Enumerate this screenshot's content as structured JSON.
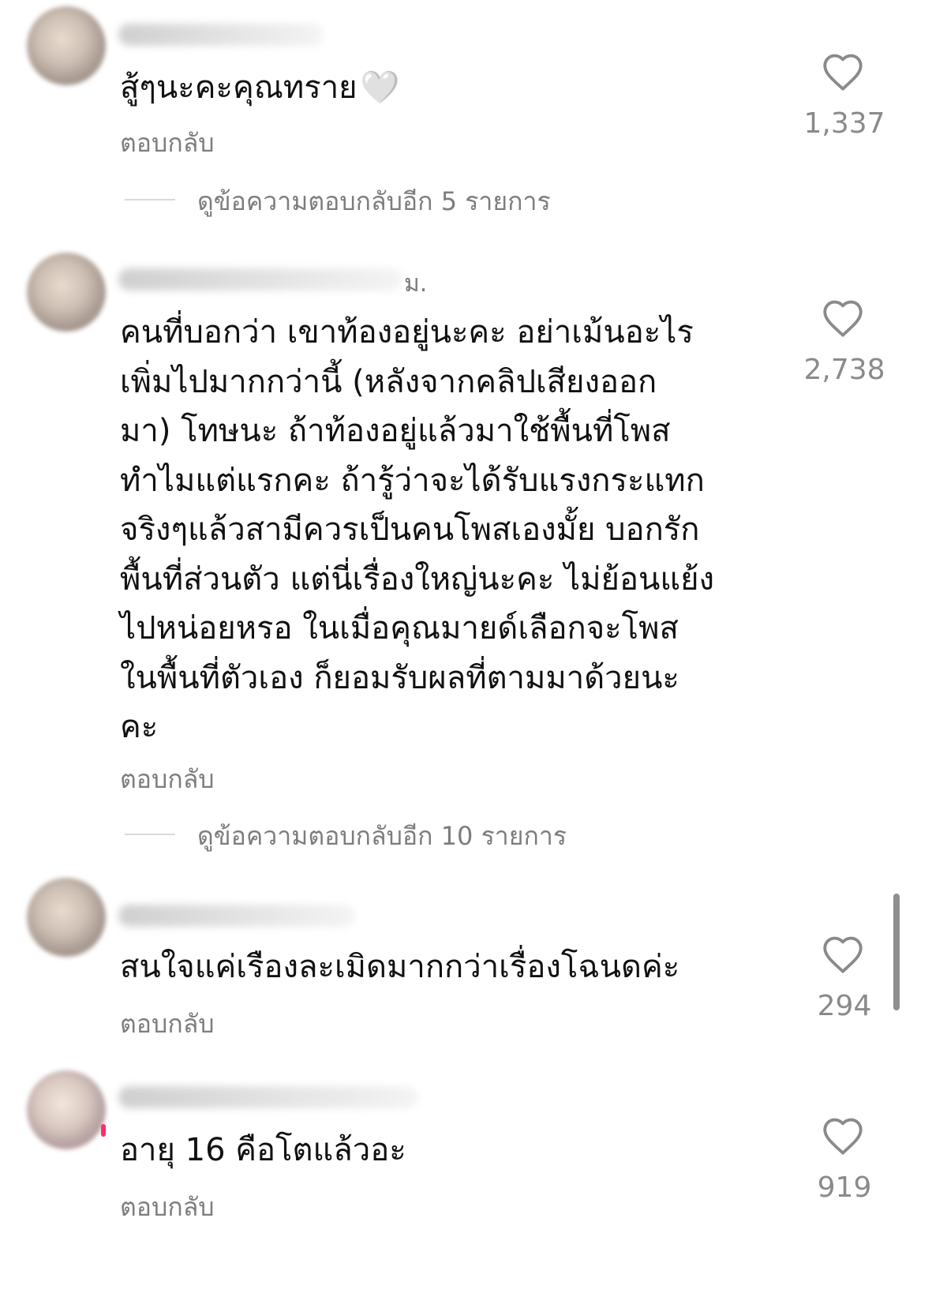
{
  "comments": [
    {
      "text": "สู้ๆนะคะคุณทราย",
      "emoji": "🤍",
      "likes": "1,337",
      "reply_label": "ตอบกลับ",
      "view_replies": "ดูข้อความตอบกลับอีก 5 รายการ"
    },
    {
      "timestamp": "ม.",
      "text": "คนที่บอกว่า เขาท้องอยู่นะคะ อย่าเม้นอะไร\nเพิ่มไปมากกว่านี้ (หลังจากคลิปเสียงออก\nมา) โทษนะ ถ้าท้องอยู่แล้วมาใช้พื้นที่โพส\nทำไมแต่แรกคะ ถ้ารู้ว่าจะได้รับแรงกระแทก\nจริงๆแล้วสามีควรเป็นคนโพสเองมั้ย บอกรัก\nพื้นที่ส่วนตัว แต่นี่เรื่องใหญ่นะคะ ไม่ย้อนแย้ง\nไปหน่อยหรอ ในเมื่อคุณมายด์เลือกจะโพส\nในพื้นที่ตัวเอง ก็ยอมรับผลที่ตามมาด้วยนะ\nคะ",
      "likes": "2,738",
      "reply_label": "ตอบกลับ",
      "view_replies": "ดูข้อความตอบกลับอีก 10 รายการ"
    },
    {
      "text": "สนใจแค่เรืองละเมิดมากกว่าเรื่องโฉนดค่ะ",
      "likes": "294",
      "reply_label": "ตอบกลับ"
    },
    {
      "text": "อายุ 16 คือโตแล้วอะ",
      "likes": "919",
      "reply_label": "ตอบกลับ"
    }
  ],
  "icons": {
    "like": "heart-outline-icon"
  },
  "colors": {
    "text": "#111111",
    "secondary": "#7d7d7d",
    "accent": "#ff2d6f"
  }
}
